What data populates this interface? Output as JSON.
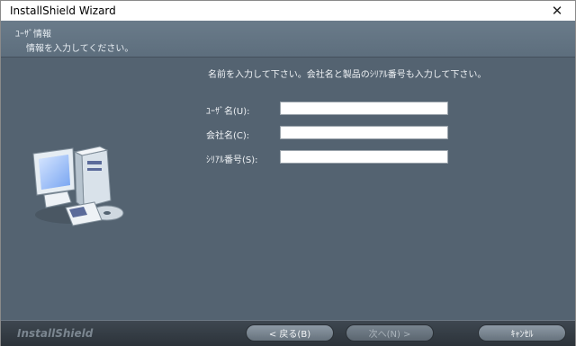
{
  "window": {
    "title": "InstallShield Wizard",
    "close_label": "✕"
  },
  "header": {
    "title": "ﾕｰｻﾞ情報",
    "subtitle": "情報を入力してください。"
  },
  "main": {
    "instruction": "名前を入力して下さい。会社名と製品のｼﾘｱﾙ番号も入力して下さい。",
    "fields": [
      {
        "label": "ﾕｰｻﾞ名(U):",
        "value": ""
      },
      {
        "label": "会社名(C):",
        "value": ""
      },
      {
        "label": "ｼﾘｱﾙ番号(S):",
        "value": ""
      }
    ],
    "illustration_icon": "computer-with-cd-icon"
  },
  "footer": {
    "logo": "InstallShield",
    "back_label": "< 戻る(B)",
    "next_label": "次へ(N) >",
    "cancel_label": "ｷｬﾝｾﾙ",
    "next_enabled": false
  }
}
